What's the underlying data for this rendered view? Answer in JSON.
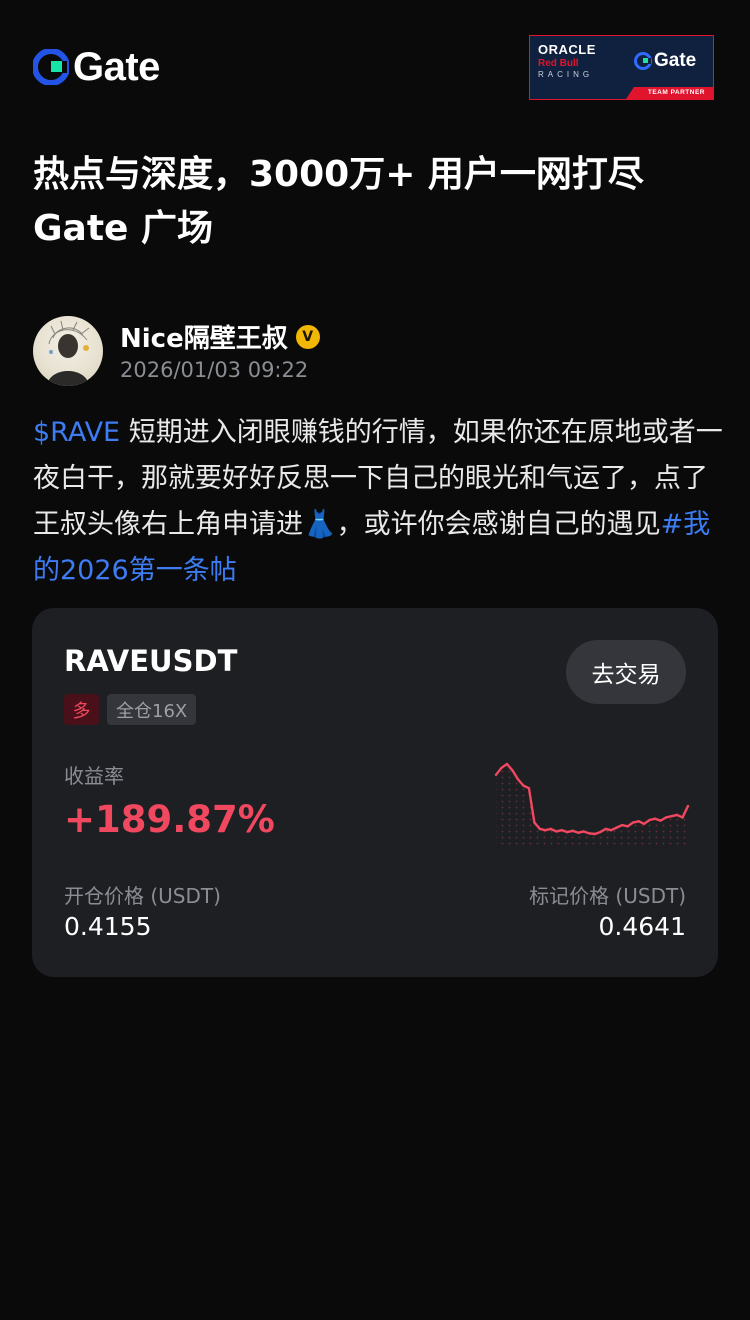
{
  "header": {
    "logo_text": "Gate",
    "partner": {
      "line1": "ORACLE",
      "line2": "Red Bull",
      "line3": "RACING",
      "brand": "Gate",
      "caption": "TEAM PARTNER"
    }
  },
  "headline": {
    "line1": "热点与深度，3000万+ 用户一网打尽",
    "line2": "Gate 广场"
  },
  "post": {
    "author": "Nice隔壁王叔",
    "verified_mark": "V",
    "timestamp": "2026/01/03 09:22",
    "ticker": "$RAVE",
    "body": " 短期进入闭眼赚钱的行情，如果你还在原地或者一夜白干，那就要好好反思一下自己的眼光和气运了，点了王叔头像右上角申请进👗，或许你会感谢自己的遇见",
    "hashtag": "#我的2026第一条帖"
  },
  "position_card": {
    "pair": "RAVEUSDT",
    "trade_button": "去交易",
    "side": "多",
    "leverage": "全仓16X",
    "pnl_label": "收益率",
    "pnl_value": "+189.87%",
    "open_label": "开仓价格 (USDT)",
    "open_value": "0.4155",
    "mark_label": "标记价格 (USDT)",
    "mark_value": "0.4641",
    "accent_color": "#f0485f"
  },
  "chart_data": {
    "type": "line",
    "values": [
      0.545,
      0.556,
      0.562,
      0.552,
      0.538,
      0.528,
      0.524,
      0.47,
      0.46,
      0.458,
      0.46,
      0.456,
      0.458,
      0.455,
      0.457,
      0.454,
      0.456,
      0.453,
      0.452,
      0.455,
      0.46,
      0.458,
      0.462,
      0.466,
      0.464,
      0.47,
      0.472,
      0.468,
      0.474,
      0.476,
      0.473,
      0.478,
      0.48,
      0.482,
      0.478,
      0.496
    ],
    "color": "#f0485f"
  }
}
